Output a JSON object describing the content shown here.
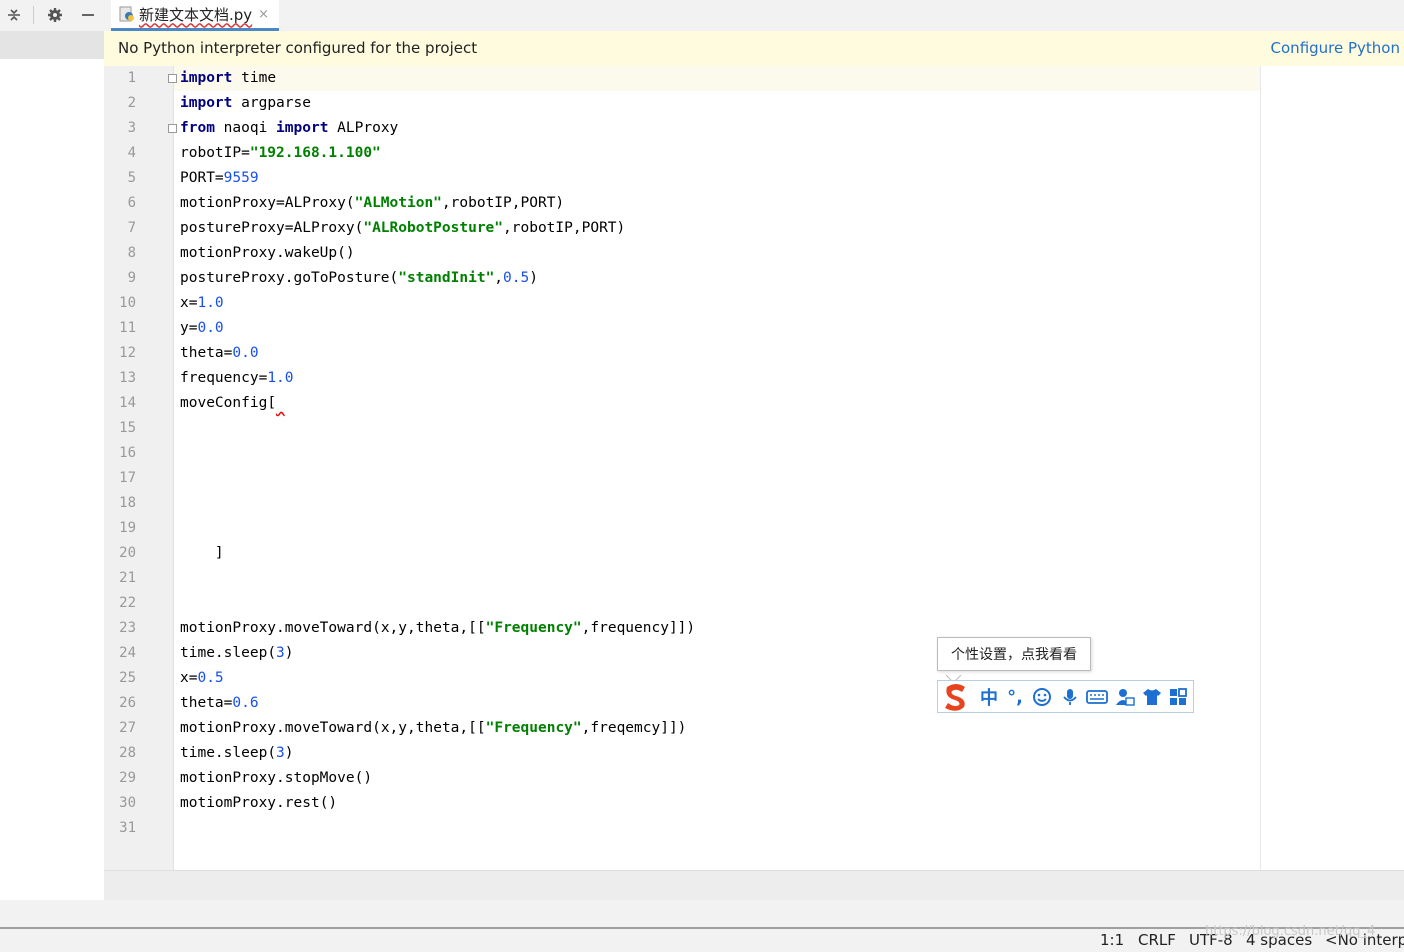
{
  "tab": {
    "filename": "新建文本文档.py",
    "close": "×"
  },
  "notification": {
    "message": "No Python interpreter configured for the project",
    "action": "Configure Python"
  },
  "editor": {
    "line_numbers": [
      "1",
      "2",
      "3",
      "4",
      "5",
      "6",
      "7",
      "8",
      "9",
      "10",
      "11",
      "12",
      "13",
      "14",
      "15",
      "16",
      "17",
      "18",
      "19",
      "20",
      "21",
      "22",
      "23",
      "24",
      "25",
      "26",
      "27",
      "28",
      "29",
      "30",
      "31"
    ],
    "lines": [
      "import time",
      "import argparse",
      "from naoqi import ALProxy",
      "robotIP=\"192.168.1.100\"",
      "PORT=9559",
      "motionProxy=ALProxy(\"ALMotion\",robotIP,PORT)",
      "postureProxy=ALProxy(\"ALRobotPosture\",robotIP,PORT)",
      "motionProxy.wakeUp()",
      "postureProxy.goToPosture(\"standInit\",0.5)",
      "x=1.0",
      "y=0.0",
      "theta=0.0",
      "frequency=1.0",
      "moveConfig[",
      "",
      "",
      "",
      "",
      "",
      "    ]",
      "",
      "",
      "motionProxy.moveToward(x,y,theta,[[\"Frequency\",frequency]])",
      "time.sleep(3)",
      "x=0.5",
      "theta=0.6",
      "motionProxy.moveToward(x,y,theta,[[\"Frequency\",freqemcy]])",
      "time.sleep(3)",
      "motionProxy.stopMove()",
      "motiomProxy.rest()",
      ""
    ]
  },
  "ime": {
    "tooltip": "个性设置，点我看看",
    "mode": "中",
    "punct": "°,"
  },
  "status": {
    "position": "1:1",
    "line_sep": "CRLF",
    "encoding": "UTF-8",
    "indent": "4 spaces",
    "interpreter": "<No interp"
  },
  "watermark": "https://blog.csdn.net/qq_4"
}
